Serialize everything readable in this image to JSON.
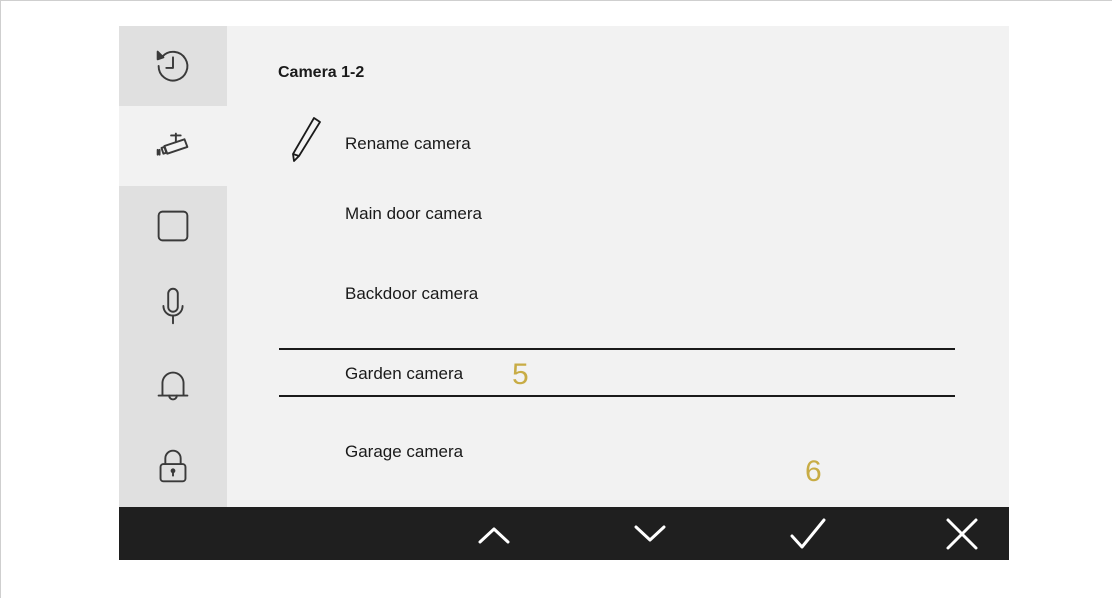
{
  "sidebar": {
    "items": [
      {
        "icon": "history-icon",
        "active": false
      },
      {
        "icon": "camera-icon",
        "active": true
      },
      {
        "icon": "square-icon",
        "active": false
      },
      {
        "icon": "microphone-icon",
        "active": false
      },
      {
        "icon": "bell-icon",
        "active": false
      },
      {
        "icon": "lock-icon",
        "active": false
      }
    ]
  },
  "main": {
    "title": "Camera 1-2",
    "rename_label": "Rename camera",
    "cameras": [
      "Main door camera",
      "Backdoor camera",
      "Garden camera",
      "Garage camera"
    ],
    "selected_camera": "Garden camera"
  },
  "annotations": {
    "marker_5": "5",
    "marker_6": "6"
  },
  "bottom_bar": {
    "buttons": [
      "chevron-up-icon",
      "chevron-down-icon",
      "check-icon",
      "close-icon"
    ]
  },
  "colors": {
    "accent_annotation": "#c8ac45",
    "bar_bg": "#1f1f1f",
    "sidebar_bg": "#e0e0e0",
    "panel_bg": "#f2f2f2"
  }
}
